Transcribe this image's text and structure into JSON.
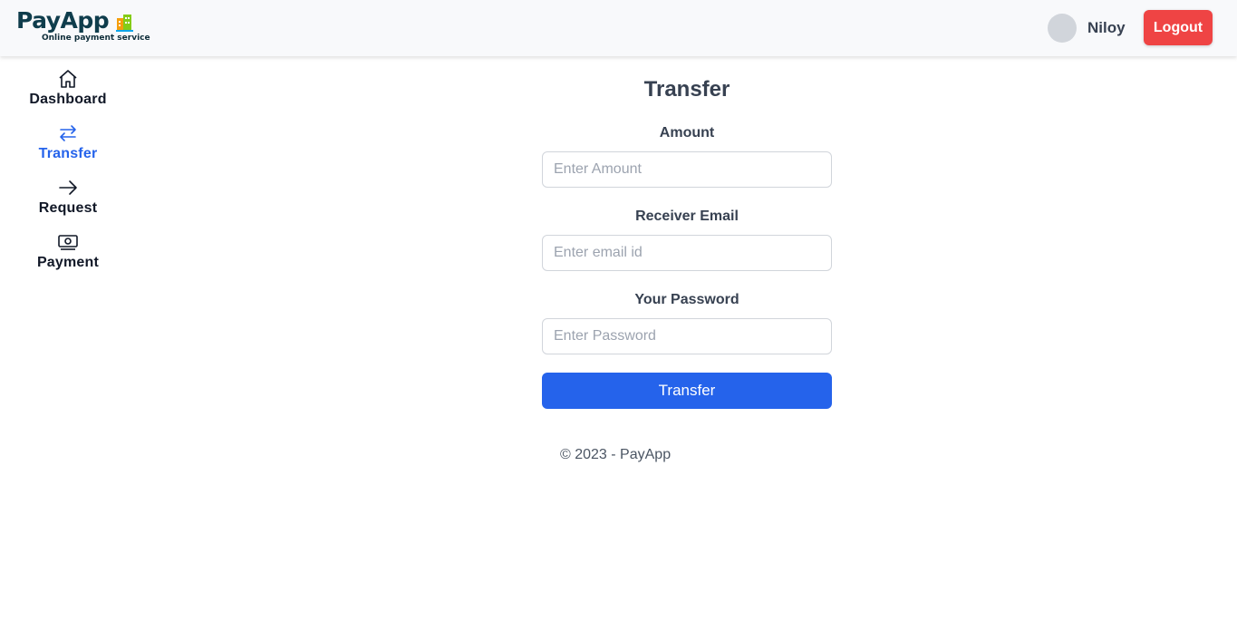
{
  "header": {
    "logo_title": "PayApp",
    "logo_subtitle": "Online payment service",
    "username": "Niloy",
    "logout_label": "Logout"
  },
  "sidebar": {
    "items": [
      {
        "label": "Dashboard",
        "icon": "home-icon",
        "active": false
      },
      {
        "label": "Transfer",
        "icon": "arrows-exchange-icon",
        "active": true
      },
      {
        "label": "Request",
        "icon": "arrow-right-icon",
        "active": false
      },
      {
        "label": "Payment",
        "icon": "banknote-icon",
        "active": false
      }
    ]
  },
  "main": {
    "title": "Transfer",
    "fields": [
      {
        "label": "Amount",
        "placeholder": "Enter Amount",
        "value": ""
      },
      {
        "label": "Receiver Email",
        "placeholder": "Enter email id",
        "value": ""
      },
      {
        "label": "Your Password",
        "placeholder": "Enter Password",
        "value": ""
      }
    ],
    "submit_label": "Transfer"
  },
  "footer": {
    "text": "© 2023 - PayApp"
  },
  "colors": {
    "primary": "#2563eb",
    "danger": "#ef4444",
    "brand": "#0f3d4c"
  }
}
